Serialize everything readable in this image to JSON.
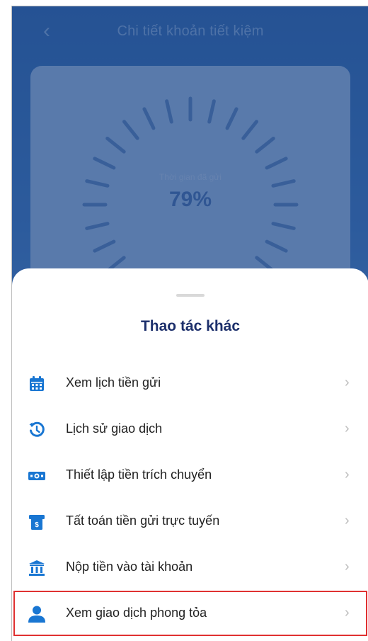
{
  "background": {
    "back_icon": "chevron-left-icon",
    "title": "Chi tiết khoản tiết kiệm",
    "dial_label": "Thời gian đã gửi",
    "dial_value": "79%"
  },
  "sheet": {
    "title": "Thao tác khác",
    "items": [
      {
        "label": "Xem lịch tiền gửi",
        "icon": "calendar-icon"
      },
      {
        "label": "Lịch sử giao dịch",
        "icon": "history-icon"
      },
      {
        "label": "Thiết lập tiền trích chuyển",
        "icon": "money-icon"
      },
      {
        "label": "Tất toán tiền gửi trực tuyến",
        "icon": "settlement-icon"
      },
      {
        "label": "Nộp tiền vào tài khoản",
        "icon": "bank-icon"
      },
      {
        "label": "Xem giao dịch phong tỏa",
        "icon": "user-icon"
      }
    ],
    "chevron": "›",
    "highlighted_item": "Xem giao dịch phong tỏa"
  },
  "colors": {
    "accent": "#1976d2",
    "title": "#1c2f6b",
    "highlight_border": "#e03131"
  }
}
